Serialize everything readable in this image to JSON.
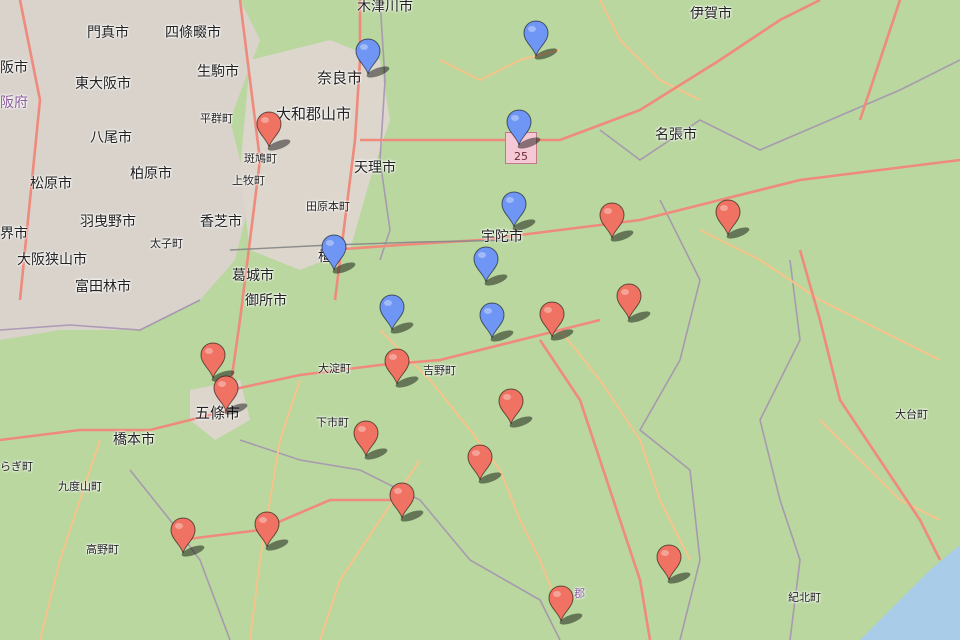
{
  "colors": {
    "land": "#b9d79f",
    "urban": "#d9d3cc",
    "road_major": "#ef8a7c",
    "road_minor": "#f6c48a",
    "boundary": "#a48fb1",
    "water": "#a9cce8",
    "marker_blue": "#6f95f5",
    "marker_red": "#f07262"
  },
  "labels": [
    {
      "text": "木津川市"
    },
    {
      "text": "伊賀市"
    },
    {
      "text": "門真市"
    },
    {
      "text": "四條畷市"
    },
    {
      "text": "阪市"
    },
    {
      "text": "東大阪市"
    },
    {
      "text": "生駒市"
    },
    {
      "text": "奈良市"
    },
    {
      "text": "阪府"
    },
    {
      "text": "平群町"
    },
    {
      "text": "大和郡山市"
    },
    {
      "text": "八尾市"
    },
    {
      "text": "斑鳩町"
    },
    {
      "text": "名張市"
    },
    {
      "text": "天理市"
    },
    {
      "text": "松原市"
    },
    {
      "text": "柏原市"
    },
    {
      "text": "上牧町"
    },
    {
      "text": "羽曳野市"
    },
    {
      "text": "香芝市"
    },
    {
      "text": "田原本町"
    },
    {
      "text": "宇陀市"
    },
    {
      "text": "界市"
    },
    {
      "text": "太子町"
    },
    {
      "text": "橿"
    },
    {
      "text": "大阪狭山市"
    },
    {
      "text": "葛城市"
    },
    {
      "text": "富田林市"
    },
    {
      "text": "御所市"
    },
    {
      "text": "大淀町"
    },
    {
      "text": "吉野町"
    },
    {
      "text": "五條市"
    },
    {
      "text": "下市町"
    },
    {
      "text": "大台町"
    },
    {
      "text": "橋本市"
    },
    {
      "text": "らぎ町"
    },
    {
      "text": "九度山町"
    },
    {
      "text": "高野町"
    },
    {
      "text": "紀北町"
    },
    {
      "text": "郡"
    }
  ],
  "route_shield": {
    "number": "25"
  },
  "markers": [
    {
      "color": "blue",
      "name": "marker-nara-north"
    },
    {
      "color": "blue",
      "name": "marker-northeast"
    },
    {
      "color": "blue",
      "name": "marker-route25"
    },
    {
      "color": "blue",
      "name": "marker-uda-north"
    },
    {
      "color": "blue",
      "name": "marker-kashihara"
    },
    {
      "color": "blue",
      "name": "marker-uda-south"
    },
    {
      "color": "blue",
      "name": "marker-yoshino-west"
    },
    {
      "color": "blue",
      "name": "marker-yoshino-east"
    },
    {
      "color": "red",
      "name": "marker-ikaruga"
    },
    {
      "color": "red",
      "name": "marker-uda-east"
    },
    {
      "color": "red",
      "name": "marker-nabari-south"
    },
    {
      "color": "red",
      "name": "marker-higashi-yoshino"
    },
    {
      "color": "red",
      "name": "marker-yoshino-river"
    },
    {
      "color": "red",
      "name": "marker-gojo-north"
    },
    {
      "color": "red",
      "name": "marker-gojo"
    },
    {
      "color": "red",
      "name": "marker-yoshino-town"
    },
    {
      "color": "red",
      "name": "marker-kawakami"
    },
    {
      "color": "red",
      "name": "marker-shimoichi"
    },
    {
      "color": "red",
      "name": "marker-kurotaki"
    },
    {
      "color": "red",
      "name": "marker-tenkawa"
    },
    {
      "color": "red",
      "name": "marker-koya-east"
    },
    {
      "color": "red",
      "name": "marker-nosegawa"
    },
    {
      "color": "red",
      "name": "marker-kamikitayama"
    },
    {
      "color": "red",
      "name": "marker-totsukawa"
    }
  ]
}
